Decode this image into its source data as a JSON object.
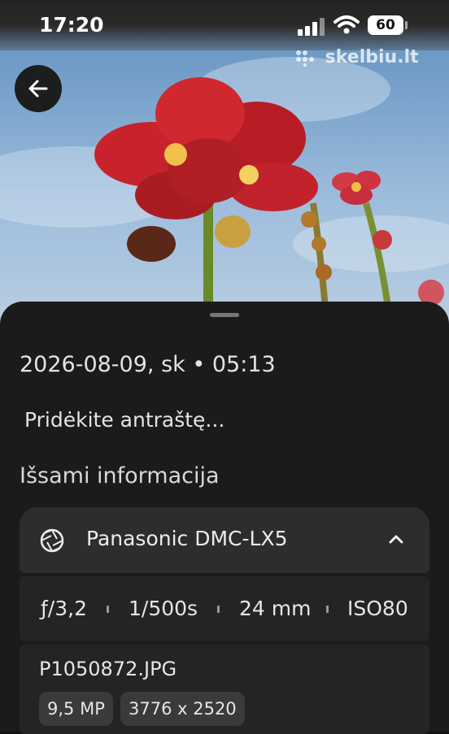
{
  "status_bar": {
    "time": "17:20",
    "battery": "60"
  },
  "photo": {
    "watermark": "skelbiu.lt"
  },
  "info": {
    "date": "2026-08-09, sk  •  05:13",
    "caption_placeholder": "Pridėkite antraštę...",
    "details_heading": "Išsami informacija",
    "camera": "Panasonic DMC-LX5",
    "aperture": "ƒ/3,2",
    "shutter": "1/500s",
    "focal_length": "24 mm",
    "iso": "ISO80",
    "filename": "P1050872.JPG",
    "megapixels": "9,5 MP",
    "resolution": "3776 x 2520"
  }
}
